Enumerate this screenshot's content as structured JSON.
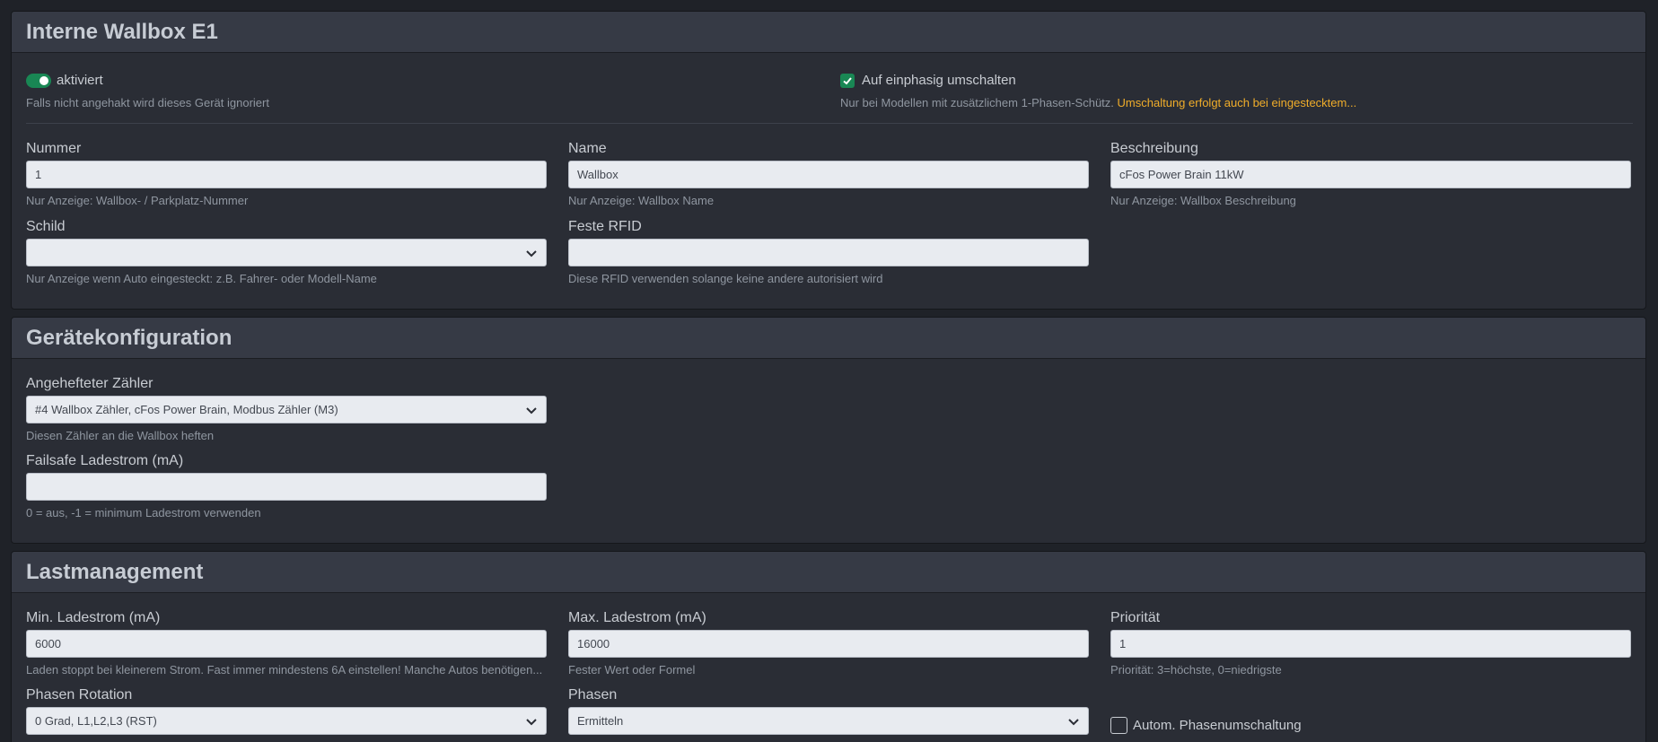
{
  "colors": {
    "background": "#1f2228",
    "card": "#2a2d35",
    "header": "#363a45",
    "accent_green": "#198754",
    "link_orange": "#f0ad2a",
    "input_bg": "#e8ebf0"
  },
  "wallbox": {
    "title": "Interne Wallbox E1",
    "enabled": {
      "label": "aktiviert",
      "help": "Falls nicht angehakt wird dieses Gerät ignoriert",
      "checked": true
    },
    "single_phase": {
      "label": "Auf einphasig umschalten",
      "help": "Nur bei Modellen mit zusätzlichem 1-Phasen-Schütz.",
      "link": "Umschaltung erfolgt auch bei eingestecktem...",
      "checked": true
    },
    "nummer": {
      "label": "Nummer",
      "value": "1",
      "help": "Nur Anzeige: Wallbox- / Parkplatz-Nummer"
    },
    "name": {
      "label": "Name",
      "value": "Wallbox",
      "help": "Nur Anzeige: Wallbox Name"
    },
    "beschreibung": {
      "label": "Beschreibung",
      "value": "cFos Power Brain 11kW",
      "help": "Nur Anzeige: Wallbox Beschreibung"
    },
    "schild": {
      "label": "Schild",
      "value": "",
      "help": "Nur Anzeige wenn Auto eingesteckt: z.B. Fahrer- oder Modell-Name"
    },
    "rfid": {
      "label": "Feste RFID",
      "value": "",
      "help": "Diese RFID verwenden solange keine andere autorisiert wird"
    }
  },
  "geraet": {
    "title": "Gerätekonfiguration",
    "zaehler": {
      "label": "Angehefteter Zähler",
      "value": "#4 Wallbox Zähler, cFos Power Brain, Modbus Zähler (M3)",
      "help": "Diesen Zähler an die Wallbox heften"
    },
    "failsafe": {
      "label": "Failsafe Ladestrom (mA)",
      "value": "",
      "help": "0 = aus, -1 = minimum Ladestrom verwenden"
    }
  },
  "last": {
    "title": "Lastmanagement",
    "min": {
      "label": "Min. Ladestrom (mA)",
      "value": "6000",
      "help": "Laden stoppt bei kleinerem Strom. Fast immer mindestens 6A einstellen! Manche Autos benötigen..."
    },
    "max": {
      "label": "Max. Ladestrom (mA)",
      "value": "16000",
      "help": "Fester Wert oder Formel"
    },
    "prio": {
      "label": "Priorität",
      "value": "1",
      "help": "Priorität: 3=höchste, 0=niedrigste"
    },
    "rotation": {
      "label": "Phasen Rotation",
      "value": "0 Grad, L1,L2,L3 (RST)"
    },
    "phasen": {
      "label": "Phasen",
      "value": "Ermitteln"
    },
    "auto_phase": {
      "label": "Autom. Phasenumschaltung",
      "checked": false
    }
  }
}
